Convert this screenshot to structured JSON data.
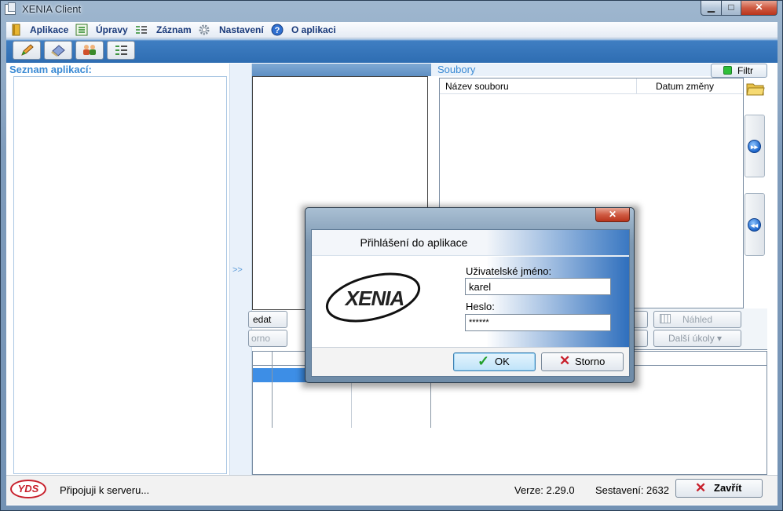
{
  "window": {
    "title": "XENIA Client"
  },
  "menu": {
    "items": [
      {
        "label": "Aplikace",
        "icon": "book-icon"
      },
      {
        "label": "Úpravy",
        "icon": "list-icon"
      },
      {
        "label": "Záznam",
        "icon": "record-icon"
      },
      {
        "label": "Nastavení",
        "icon": "gear-icon"
      },
      {
        "label": "O aplikaci",
        "icon": "help-icon"
      }
    ]
  },
  "toolbar": {
    "buttons": [
      "pencil-icon",
      "eraser-icon",
      "users-icon",
      "record-add-icon"
    ]
  },
  "left_panel": {
    "header": "Seznam aplikací:",
    "splitter_arrow": ">>"
  },
  "middle_panel": {
    "search_label": "edat",
    "cancel_label": "orno"
  },
  "files_panel": {
    "header": "Soubory",
    "filter_label": "Filtr",
    "columns": [
      "Název souboru",
      "Datum změny"
    ],
    "preview_label": "Náhled",
    "more_tasks_label": "Další úkoly ▾"
  },
  "status": {
    "message": "Připojuji k serveru...",
    "version": "Verze: 2.29.0",
    "build": "Sestavení: 2632",
    "close_label": "Zavřít",
    "logo_text": "YDS"
  },
  "login_dialog": {
    "title": "Přihlášení do aplikace",
    "logo_text": "XENIA",
    "username_label": "Uživatelské jméno:",
    "username_value": "karel",
    "password_label": "Heslo:",
    "password_value": "******",
    "ok_label": "OK",
    "cancel_label": "Storno"
  },
  "colors": {
    "accent": "#3a8ad4",
    "selection": "#3d8ee6",
    "close_red": "#c8202c"
  }
}
